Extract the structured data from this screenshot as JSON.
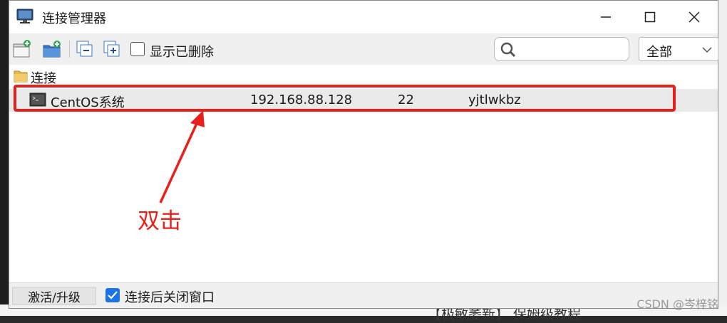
{
  "window": {
    "title": "连接管理器"
  },
  "toolbar": {
    "show_deleted_label": "显示已删除",
    "show_deleted_checked": false,
    "search_placeholder": "",
    "filter_value": "全部"
  },
  "tree": {
    "folder_label": "连接",
    "connections": [
      {
        "name": "CentOS系统",
        "host": "192.168.88.128",
        "port": "22",
        "user": "yjtlwkbz"
      }
    ]
  },
  "annotation": {
    "text": "双击",
    "color": "#e8201c"
  },
  "statusbar": {
    "upgrade_label": "激活/升级",
    "close_after_label": "连接后关闭窗口",
    "close_after_checked": true
  },
  "background": {
    "bottom_text": "【极敏萎新】 保姆级教程",
    "watermark": "CSDN @岑梓铭"
  },
  "colors": {
    "accent": "#1a73e8",
    "highlight": "#e8201c"
  }
}
